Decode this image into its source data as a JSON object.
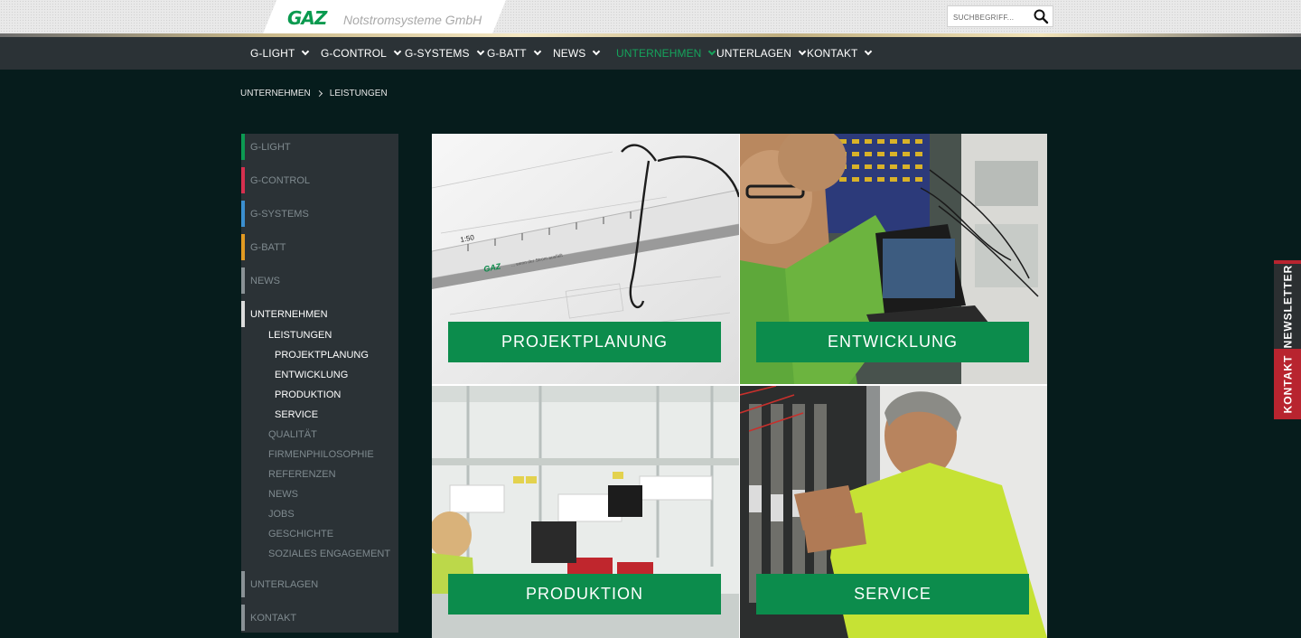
{
  "header": {
    "logo_mark": "GAZ",
    "company": "Notstromsysteme GmbH",
    "search_placeholder": "SUCHBEGRIFF..."
  },
  "nav": [
    {
      "label": "G-LIGHT",
      "active": false
    },
    {
      "label": "G-CONTROL",
      "active": false
    },
    {
      "label": "G-SYSTEMS",
      "active": false
    },
    {
      "label": "G-BATT",
      "active": false
    },
    {
      "label": "NEWS",
      "active": false
    },
    {
      "label": "UNTERNEHMEN",
      "active": true
    },
    {
      "label": "UNTERLAGEN",
      "active": false
    },
    {
      "label": "KONTAKT",
      "active": false
    }
  ],
  "breadcrumb": [
    "UNTERNEHMEN",
    "LEISTUNGEN"
  ],
  "sidebar": {
    "categories": [
      {
        "label": "G-LIGHT",
        "color": "#0c9a52"
      },
      {
        "label": "G-CONTROL",
        "color": "#d6304f"
      },
      {
        "label": "G-SYSTEMS",
        "color": "#3b8fd0"
      },
      {
        "label": "G-BATT",
        "color": "#e29a22"
      },
      {
        "label": "NEWS",
        "color": "#8a9296"
      },
      {
        "label": "UNTERNEHMEN",
        "color": "#dcdcdc"
      },
      {
        "label": "UNTERLAGEN",
        "color": "#8a9296"
      },
      {
        "label": "KONTAKT",
        "color": "#8a9296"
      }
    ],
    "unternehmen_items": [
      {
        "label": "LEISTUNGEN",
        "level": 1,
        "highlight": true
      },
      {
        "label": "PROJEKTPLANUNG",
        "level": 2,
        "highlight": true
      },
      {
        "label": "ENTWICKLUNG",
        "level": 2,
        "highlight": true
      },
      {
        "label": "PRODUKTION",
        "level": 2,
        "highlight": true
      },
      {
        "label": "SERVICE",
        "level": 2,
        "highlight": true
      },
      {
        "label": "QUALITÄT",
        "level": 1,
        "highlight": false
      },
      {
        "label": "FIRMENPHILOSOPHIE",
        "level": 1,
        "highlight": false
      },
      {
        "label": "REFERENZEN",
        "level": 1,
        "highlight": false
      },
      {
        "label": "NEWS",
        "level": 1,
        "highlight": false
      },
      {
        "label": "JOBS",
        "level": 1,
        "highlight": false
      },
      {
        "label": "GESCHICHTE",
        "level": 1,
        "highlight": false
      },
      {
        "label": "SOZIALES ENGAGEMENT",
        "level": 1,
        "highlight": false
      }
    ]
  },
  "tiles": [
    {
      "label": "PROJEKTPLANUNG"
    },
    {
      "label": "ENTWICKLUNG"
    },
    {
      "label": "PRODUKTION"
    },
    {
      "label": "SERVICE"
    }
  ],
  "ruler": {
    "scale": "1:50",
    "brand": "GAZ",
    "tagline": "... wenn der Strom ausfällt"
  },
  "side_tabs": {
    "newsletter": "NEWSLETTER",
    "kontakt": "KONTAKT"
  },
  "colors": {
    "accent_green": "#0c8c4c",
    "nav_bg": "#2b3236",
    "page_bg": "#061c1c",
    "kontakt_tab": "#b8242f"
  }
}
